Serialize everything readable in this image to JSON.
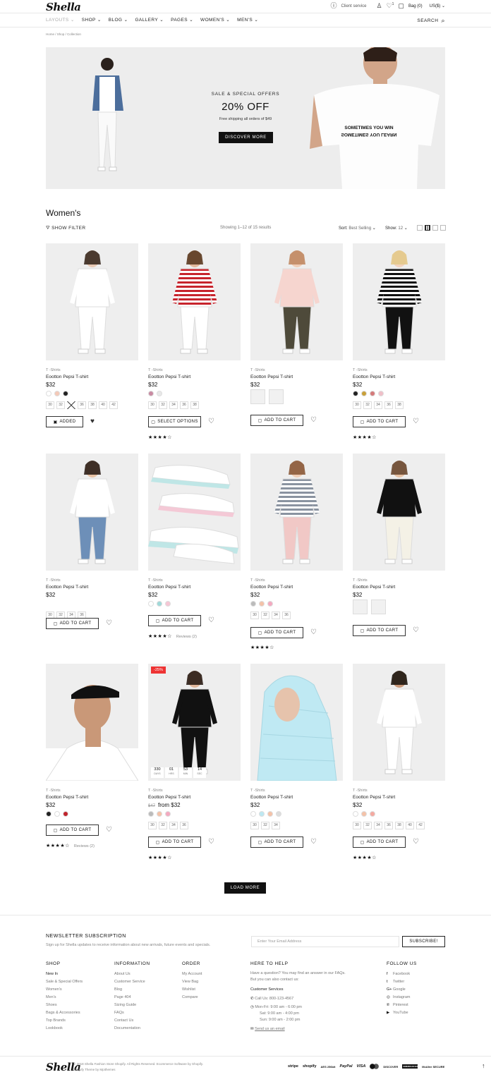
{
  "header": {
    "logo": "Shella",
    "client_service": "Client service",
    "wishlist_count": "1",
    "bag": "Bag (0)",
    "currency": "US($)",
    "search": "SEARCH",
    "nav": [
      "LAYOUTS",
      "SHOP",
      "BLOG",
      "GALLERY",
      "PAGES",
      "WOMEN'S",
      "MEN'S"
    ]
  },
  "breadcrumb": [
    "Home",
    "Shop",
    "Collection"
  ],
  "hero": {
    "kicker": "SALE & SPECIAL OFFERS",
    "headline": "20% OFF",
    "sub": "Free shipping all orders of $49",
    "button": "DISCOVER MORE",
    "shirt_line1": "SOMETIMES YOU WIN",
    "shirt_line2": "SOMETIMES YOU LEARN"
  },
  "collection": {
    "title": "Women's",
    "filter": "SHOW FILTER",
    "showing": "Showing 1–12 of 15 results",
    "sort_label": "Sort:",
    "sort_value": "Best Selling",
    "show_label": "Show:",
    "show_value": "12"
  },
  "products": [
    {
      "cat": "T -Shirts",
      "name": "Eootton Pepsi T-shirt",
      "price": "$32",
      "old": "",
      "swatches": [
        "#ffffff",
        "#f4c9b8",
        "#222222"
      ],
      "sizes": [
        "30",
        "32",
        "",
        "36",
        "38",
        "40",
        "42"
      ],
      "button": "ADDED",
      "rating": "",
      "reviews": ""
    },
    {
      "cat": "T -Shirts",
      "name": "Eootton Pepsi T-shirt",
      "price": "$32",
      "old": "",
      "swatches": [
        "#c98aa2",
        "#e8e8e8"
      ],
      "sizes": [
        "30",
        "32",
        "34",
        "36",
        "38"
      ],
      "button": "SELECT OPTIONS",
      "rating": "★★★★☆",
      "reviews": ""
    },
    {
      "cat": "T -Shirts",
      "name": "Eootton Pepsi T-shirt",
      "price": "$32",
      "old": "",
      "swatches": [],
      "sizes": [],
      "button": "ADD TO CART",
      "rating": "",
      "reviews": ""
    },
    {
      "cat": "T -Shirts",
      "name": "Eootton Pepsi T-shirt",
      "price": "$32",
      "old": "",
      "swatches": [
        "#222222",
        "#c8a03a",
        "#d47a7a",
        "#f0bfc8"
      ],
      "sizes": [
        "30",
        "32",
        "34",
        "36",
        "38"
      ],
      "button": "ADD TO CART",
      "rating": "★★★★☆",
      "reviews": ""
    },
    {
      "cat": "T -Shirts",
      "name": "Eootton Pepsi T-shirt",
      "price": "$32",
      "old": "",
      "swatches": [],
      "sizes": [
        "30",
        "32",
        "34",
        "36"
      ],
      "button": "ADD TO CART",
      "rating": "",
      "reviews": ""
    },
    {
      "cat": "T -Shirts",
      "name": "Eootton Pepsi T-shirt",
      "price": "$32",
      "old": "",
      "swatches": [
        "#ffffff",
        "#9fd9d9",
        "#f6c6d4"
      ],
      "sizes": [],
      "button": "ADD TO CART",
      "rating": "★★★★☆",
      "reviews": "Reviews (2)"
    },
    {
      "cat": "T -Shirts",
      "name": "Eootton Pepsi T-shirt",
      "price": "$32",
      "old": "",
      "swatches": [
        "#bbbbbb",
        "#f4c2a8",
        "#f4a9c0"
      ],
      "sizes": [
        "30",
        "32",
        "34",
        "36"
      ],
      "button": "ADD TO CART",
      "rating": "★★★★☆",
      "reviews": ""
    },
    {
      "cat": "T -Shirts",
      "name": "Eootton Pepsi T-shirt",
      "price": "$32",
      "old": "",
      "swatches": [],
      "sizes": [],
      "button": "ADD TO CART",
      "rating": "",
      "reviews": ""
    },
    {
      "cat": "T -Shirts",
      "name": "Eootton Pepsi T-shirt",
      "price": "$32",
      "old": "",
      "swatches": [
        "#222222",
        "#ffffff",
        "#c0242c"
      ],
      "sizes": [],
      "button": "ADD TO CART",
      "rating": "★★★★☆",
      "reviews": "Reviews (2)"
    },
    {
      "cat": "T -Shirts",
      "name": "Eootton Pepsi T-shirt",
      "price": "from $32",
      "old": "$47",
      "swatches": [
        "#bbbbbb",
        "#f4c2a8",
        "#f4a9c0"
      ],
      "sizes": [
        "30",
        "32",
        "34",
        "36"
      ],
      "button": "ADD TO CART",
      "rating": "★★★★☆",
      "reviews": "",
      "badge": "-25%",
      "timer": [
        [
          "330",
          "DAYS"
        ],
        [
          "01",
          "HRS"
        ],
        [
          "53",
          "MIN"
        ],
        [
          "14",
          "SEC"
        ]
      ]
    },
    {
      "cat": "T -Shirts",
      "name": "Eootton Pepsi T-shirt",
      "price": "$32",
      "old": "",
      "swatches": [
        "#ffffff",
        "#bde8f2",
        "#f4c2a8",
        "#dddddd"
      ],
      "sizes": [
        "30",
        "32",
        "34"
      ],
      "button": "ADD TO CART",
      "rating": "",
      "reviews": ""
    },
    {
      "cat": "T -Shirts",
      "name": "Eootton Pepsi T-shirt",
      "price": "$32",
      "old": "",
      "swatches": [
        "#ffffff",
        "#f4c2a8",
        "#f4a9a0"
      ],
      "sizes": [
        "30",
        "32",
        "34",
        "36",
        "38",
        "40",
        "42"
      ],
      "button": "ADD TO CART",
      "rating": "★★★★☆",
      "reviews": ""
    }
  ],
  "load_more": "LOAD MORE",
  "newsletter": {
    "title": "NEWSLETTER SUBSCRIPTION",
    "text": "Sign up for Shella updates to receive information about new arrivals, future events and specials.",
    "placeholder": "Enter Your Email Address",
    "button": "SUBSCRIBE!"
  },
  "footer": {
    "shop": {
      "title": "SHOP",
      "items": [
        "New In",
        "Sale & Special Offers",
        "Women's",
        "Men's",
        "Shoes",
        "Bags & Accessories",
        "Top Brands",
        "Lookbook"
      ]
    },
    "information": {
      "title": "INFORMATION",
      "items": [
        "About Us",
        "Customer Service",
        "Blog",
        "Page 404",
        "Sizing Guide",
        "FAQs",
        "Contact Us",
        "Documentation"
      ]
    },
    "order": {
      "title": "ORDER",
      "items": [
        "My Account",
        "View Bag",
        "Wishlist",
        "Compare"
      ]
    },
    "help": {
      "title": "HERE TO HELP",
      "text1": "Have a question? You may find an answer in our FAQs.",
      "text2": "But you can also contact us:",
      "service": "Customer Services",
      "call": "Call Us: 800-123-4567",
      "hours1": "Mon-Fri: 9:00 am - 6:00 pm",
      "hours2": "Sat: 9:00 am - 4:00 pm",
      "hours3": "Sun: 9:00 am - 2:00 pm",
      "email": "Send us an email"
    },
    "follow": {
      "title": "FOLLOW US",
      "items": [
        "Facebook",
        "Twitter",
        "Google",
        "Instagram",
        "Pinterest",
        "YouTube"
      ]
    },
    "copyright1": "© 2018 Shella Fashion Store Shopify. All Rights Reserved. Ecommerce Software by Shopify.",
    "copyright2": "Shopify Theme by Mpithemes",
    "payments": [
      "stripe",
      "shopify",
      "AES 256bit",
      "PayPal",
      "VISA",
      "mastercard",
      "DISCOVER",
      "AMERICAN EXPRESS",
      "McAfee SECURE"
    ]
  }
}
